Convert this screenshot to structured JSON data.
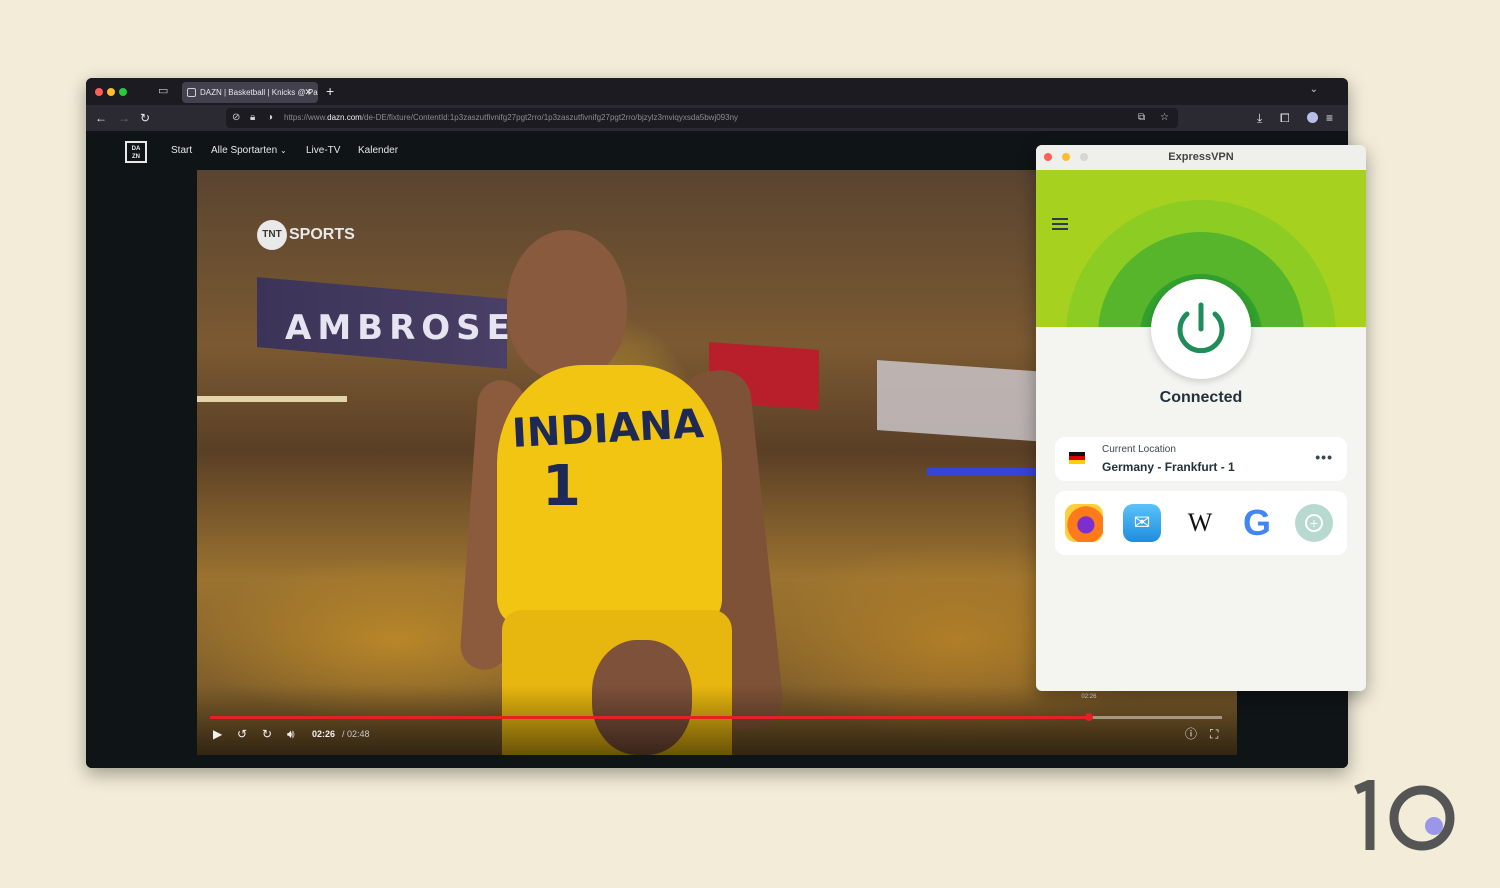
{
  "browser": {
    "tab_title": "DAZN | Basketball | Knicks @ Pa",
    "tab_close": "✕",
    "new_tab": "+",
    "url_prefix": "https://www.",
    "url_domain": "dazn.com",
    "url_path": "/de-DE/fixture/ContentId:1p3zaszutfivnifg27pgt2rro/1p3zaszutfivnifg27pgt2rro/bjzylz3mviqyxsda5bwj093ny"
  },
  "site": {
    "logo_text": "DA ZN",
    "nav": [
      "Start",
      "Alle Sportarten",
      "Live-TV",
      "Kalender"
    ]
  },
  "video": {
    "broadcaster": "SPORTS",
    "broadcaster_badge": "TNT",
    "banner_text": "AMBROSE",
    "jersey_text": "INDIANA",
    "jersey_number": "1",
    "current_time": "02:26",
    "duration": "/ 02:48",
    "hover_time": "02:26",
    "progress": 0.869
  },
  "vpn": {
    "app_title": "ExpressVPN",
    "status": "Connected",
    "location_label": "Current Location",
    "location_value": "Germany - Frankfurt - 1",
    "more": "•••",
    "shortcuts": [
      "firefox",
      "mail",
      "wikipedia",
      "google",
      "add"
    ],
    "wiki_glyph": "W",
    "google_glyph": "G",
    "add_glyph": "+"
  },
  "brand": {
    "logo_text": "10"
  },
  "colors": {
    "vpn_green": "#a6d21f",
    "power_green": "#1f8c5a",
    "progress_red": "#e42222",
    "page_bg": "#f2ecd8"
  }
}
